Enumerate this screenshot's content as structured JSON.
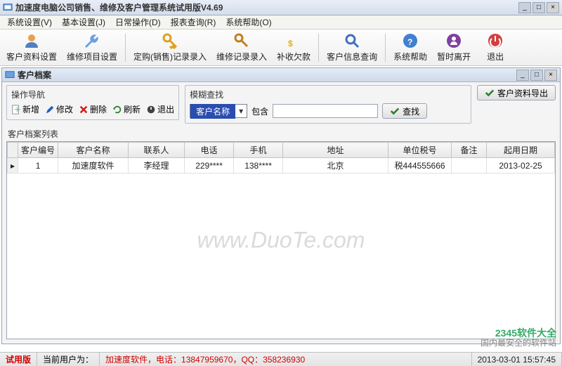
{
  "window": {
    "title": "加速度电脑公司销售、维修及客户管理系统试用版V4.69"
  },
  "menus": [
    "系统设置(V)",
    "基本设置(J)",
    "日常操作(D)",
    "报表查询(R)",
    "系统帮助(O)"
  ],
  "toolbar": [
    {
      "label": "客户资料设置"
    },
    {
      "label": "维修项目设置"
    },
    {
      "label": "定购(销售)记录录入"
    },
    {
      "label": "维修记录录入"
    },
    {
      "label": "补收欠款"
    },
    {
      "label": "客户信息查询"
    },
    {
      "label": "系统帮助"
    },
    {
      "label": "暂时离开"
    },
    {
      "label": "退出"
    }
  ],
  "inner": {
    "title": "客户档案",
    "ops_label": "操作导航",
    "ops": {
      "add": "新增",
      "edit": "修改",
      "del": "删除",
      "refresh": "刷新",
      "exit": "退出"
    },
    "search_label": "模糊查找",
    "search": {
      "field": "客户名称",
      "contains_label": "包含",
      "value": "",
      "find_label": "查找",
      "export_label": "客户资料导出"
    },
    "list_label": "客户档案列表",
    "columns": [
      "客户编号",
      "客户名称",
      "联系人",
      "电话",
      "手机",
      "地址",
      "单位税号",
      "备注",
      "起用日期"
    ],
    "rows": [
      {
        "id": "1",
        "name": "加速度软件",
        "contact": "李经理",
        "tel": "229****",
        "mobile": "138****",
        "addr": "北京",
        "tax": "税444555666",
        "note": "",
        "date": "2013-02-25"
      }
    ]
  },
  "watermark": "www.DuoTe.com",
  "bottom_logo": {
    "brand": "2345软件大全",
    "tagline": "国内最安全的软件站"
  },
  "status": {
    "trial": "试用版",
    "user_label": "当前用户为：",
    "user": "",
    "center": "加速度软件，电话：13847959670，QQ：358236930",
    "datetime": "2013-03-01 15:57:45"
  }
}
